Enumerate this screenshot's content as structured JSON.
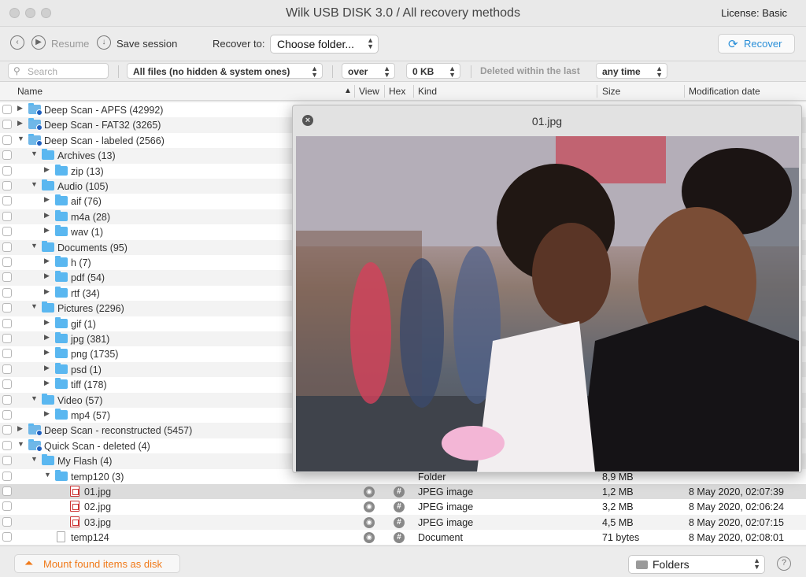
{
  "window": {
    "title": "Wilk USB DISK 3.0 / All recovery methods",
    "license": "License: Basic"
  },
  "toolbar": {
    "resume_label": "Resume",
    "save_session_label": "Save session",
    "recover_to_label": "Recover to:",
    "recover_to_value": "Choose folder...",
    "recover_button": "Recover"
  },
  "filters": {
    "search_placeholder": "Search",
    "file_filter": "All files (no hidden & system ones)",
    "size_op": "over",
    "size_value": "0 KB",
    "deleted_label": "Deleted within the last",
    "time_value": "any time"
  },
  "columns": {
    "name": "Name",
    "view": "View",
    "hex": "Hex",
    "kind": "Kind",
    "size": "Size",
    "modified": "Modification date"
  },
  "tree": [
    {
      "label": "Deep Scan - APFS (42992)",
      "expanded": false,
      "icon": "drive-icon"
    },
    {
      "label": "Deep Scan - FAT32 (3265)",
      "expanded": false,
      "icon": "drive-icon"
    },
    {
      "label": "Deep Scan - labeled (2566)",
      "expanded": true,
      "icon": "drive-icon"
    },
    {
      "label": "Archives (13)",
      "expanded": true,
      "icon": "folder-icon"
    },
    {
      "label": "zip (13)",
      "expanded": false,
      "icon": "folder-icon"
    },
    {
      "label": "Audio (105)",
      "expanded": true,
      "icon": "folder-icon"
    },
    {
      "label": "aif (76)",
      "expanded": false,
      "icon": "folder-icon"
    },
    {
      "label": "m4a (28)",
      "expanded": false,
      "icon": "folder-icon"
    },
    {
      "label": "wav (1)",
      "expanded": false,
      "icon": "folder-icon"
    },
    {
      "label": "Documents (95)",
      "expanded": true,
      "icon": "folder-icon"
    },
    {
      "label": "h (7)",
      "expanded": false,
      "icon": "folder-icon"
    },
    {
      "label": "pdf (54)",
      "expanded": false,
      "icon": "folder-icon"
    },
    {
      "label": "rtf (34)",
      "expanded": false,
      "icon": "folder-icon"
    },
    {
      "label": "Pictures (2296)",
      "expanded": true,
      "icon": "folder-icon"
    },
    {
      "label": "gif (1)",
      "expanded": false,
      "icon": "folder-icon"
    },
    {
      "label": "jpg (381)",
      "expanded": false,
      "icon": "folder-icon"
    },
    {
      "label": "png (1735)",
      "expanded": false,
      "icon": "folder-icon"
    },
    {
      "label": "psd (1)",
      "expanded": false,
      "icon": "folder-icon"
    },
    {
      "label": "tiff (178)",
      "expanded": false,
      "icon": "folder-icon"
    },
    {
      "label": "Video (57)",
      "expanded": true,
      "icon": "folder-icon"
    },
    {
      "label": "mp4 (57)",
      "expanded": false,
      "icon": "folder-icon"
    },
    {
      "label": "Deep Scan - reconstructed (5457)",
      "expanded": false,
      "icon": "drive-icon"
    },
    {
      "label": "Quick Scan - deleted (4)",
      "expanded": true,
      "icon": "drive-icon"
    },
    {
      "label": "My Flash (4)",
      "expanded": true,
      "icon": "folder-icon"
    },
    {
      "label": "temp120 (3)",
      "expanded": true,
      "icon": "folder-icon",
      "kind": "Folder",
      "size": "8,9 MB"
    },
    {
      "label": "01.jpg",
      "icon": "jpeg-file-icon",
      "kind": "JPEG image",
      "size": "1,2 MB",
      "modified": "8 May 2020, 02:07:39"
    },
    {
      "label": "02.jpg",
      "icon": "jpeg-file-icon",
      "kind": "JPEG image",
      "size": "3,2 MB",
      "modified": "8 May 2020, 02:06:24"
    },
    {
      "label": "03.jpg",
      "icon": "jpeg-file-icon",
      "kind": "JPEG image",
      "size": "4,5 MB",
      "modified": "8 May 2020, 02:07:15"
    },
    {
      "label": "temp124",
      "icon": "document-icon",
      "kind": "Document",
      "size": "71 bytes",
      "modified": "8 May 2020, 02:08:01"
    }
  ],
  "preview": {
    "title": "01.jpg"
  },
  "bottom": {
    "mount_button": "Mount found items as disk",
    "view_mode": "Folders",
    "help": "?"
  },
  "colors": {
    "accent_blue": "#2a8fd8",
    "mount_orange": "#f07a1a",
    "folder_blue": "#5ab7f0"
  }
}
